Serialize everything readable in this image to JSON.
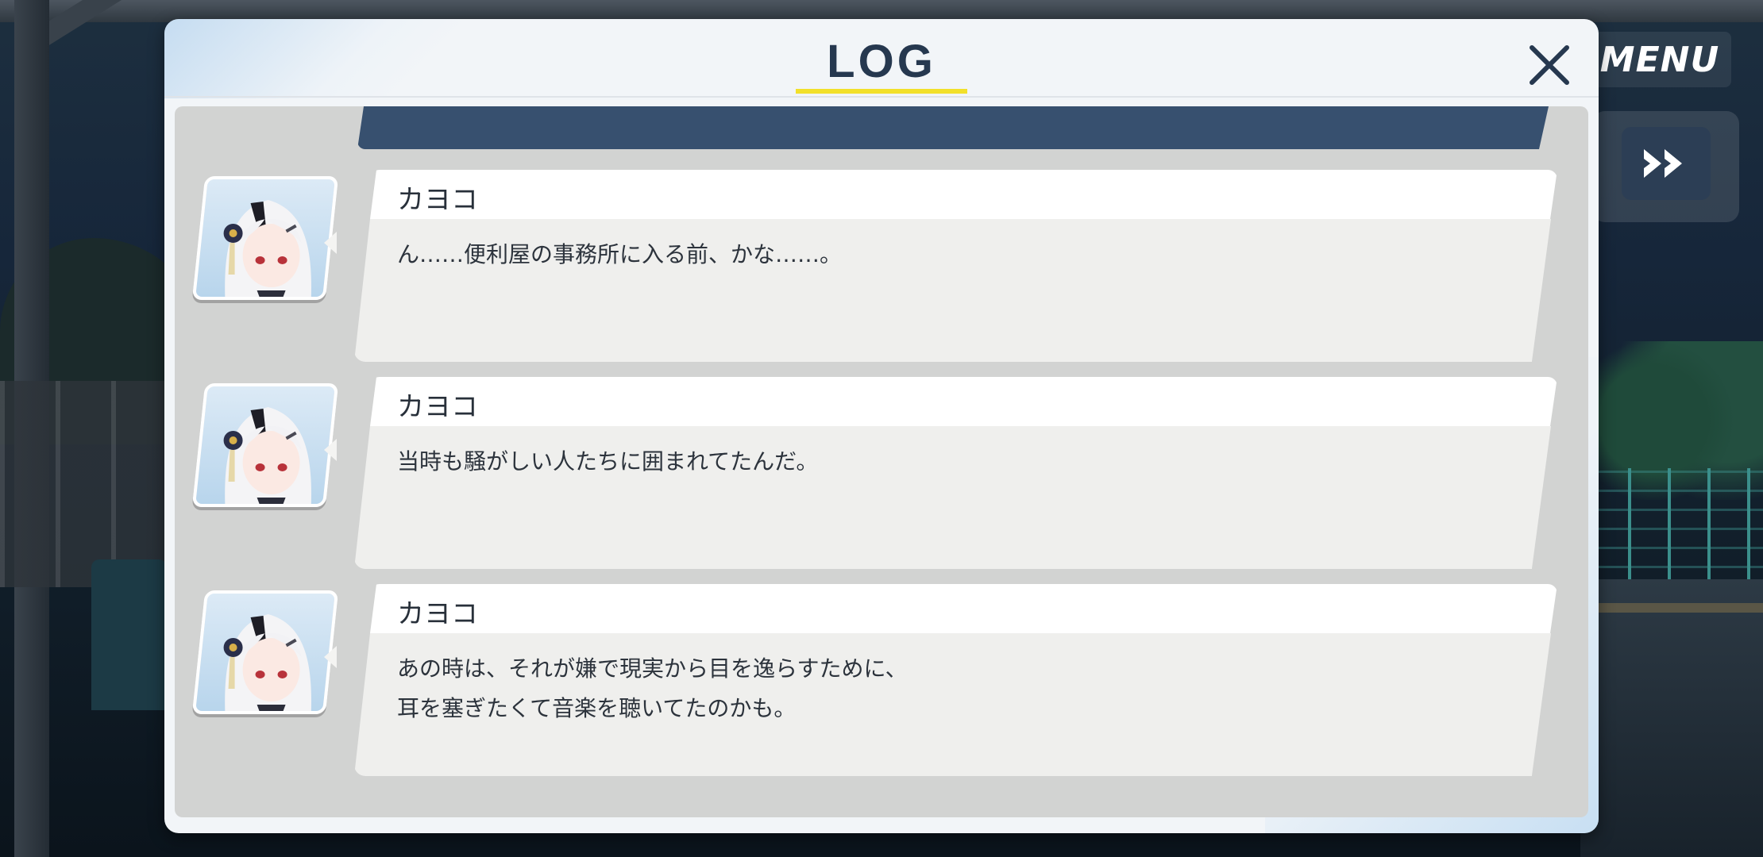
{
  "hud": {
    "menu_label": "MENU",
    "fast_forward_icon": "fast-forward-icon"
  },
  "log": {
    "title": "LOG",
    "close_icon": "close-icon",
    "accent_color": "#f2e02b",
    "entries": [
      {
        "speaker": "カヨコ",
        "lines": [
          "ん……便利屋の事務所に入る前、かな……。"
        ]
      },
      {
        "speaker": "カヨコ",
        "lines": [
          "当時も騒がしい人たちに囲まれてたんだ。"
        ]
      },
      {
        "speaker": "カヨコ",
        "lines": [
          "あの時は、それが嫌で現実から目を逸らすために、",
          "耳を塞ぎたくて音楽を聴いてたのかも。"
        ]
      }
    ]
  }
}
